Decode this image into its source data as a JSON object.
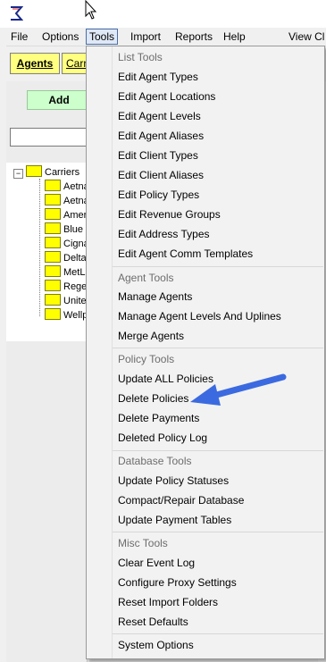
{
  "menubar": {
    "items": [
      "File",
      "Options",
      "Tools",
      "Import",
      "Reports",
      "Help",
      "View Cl"
    ],
    "active": "Tools"
  },
  "toolbar": {
    "agents_label": "Agents",
    "carriers_label": "Carri"
  },
  "left": {
    "add_label": "Add",
    "search_value": ""
  },
  "tree": {
    "root": "Carriers",
    "expander": "−",
    "children": [
      "Aetna",
      "Aetna",
      "Ameri",
      "Blue C",
      "Cigna",
      "Delta",
      "MetLi",
      "Rege",
      "Unite",
      "Wellp"
    ]
  },
  "dropdown": {
    "sections": [
      {
        "header": "List Tools",
        "items": [
          "Edit Agent Types",
          "Edit Agent Locations",
          "Edit Agent Levels",
          "Edit Agent Aliases",
          "Edit Client Types",
          "Edit Client Aliases",
          "Edit Policy Types",
          "Edit Revenue Groups",
          "Edit Address Types",
          "Edit Agent Comm Templates"
        ]
      },
      {
        "header": "Agent Tools",
        "items": [
          "Manage Agents",
          "Manage Agent Levels And Uplines",
          "Merge Agents"
        ]
      },
      {
        "header": "Policy Tools",
        "items": [
          "Update ALL Policies",
          "Delete Policies",
          "Delete Payments",
          "Deleted Policy Log"
        ]
      },
      {
        "header": "Database Tools",
        "items": [
          "Update Policy Statuses",
          "Compact/Repair Database",
          "Update Payment Tables"
        ]
      },
      {
        "header": "Misc Tools",
        "items": [
          "Clear Event Log",
          "Configure Proxy Settings",
          "Reset Import Folders",
          "Reset Defaults"
        ]
      }
    ],
    "footer_item": "System Options"
  },
  "colors": {
    "arrow": "#3b6ae0",
    "button_yellow": "#ffff80",
    "add_green": "#ccffcc",
    "menu_highlight": "#dfe8f6"
  }
}
